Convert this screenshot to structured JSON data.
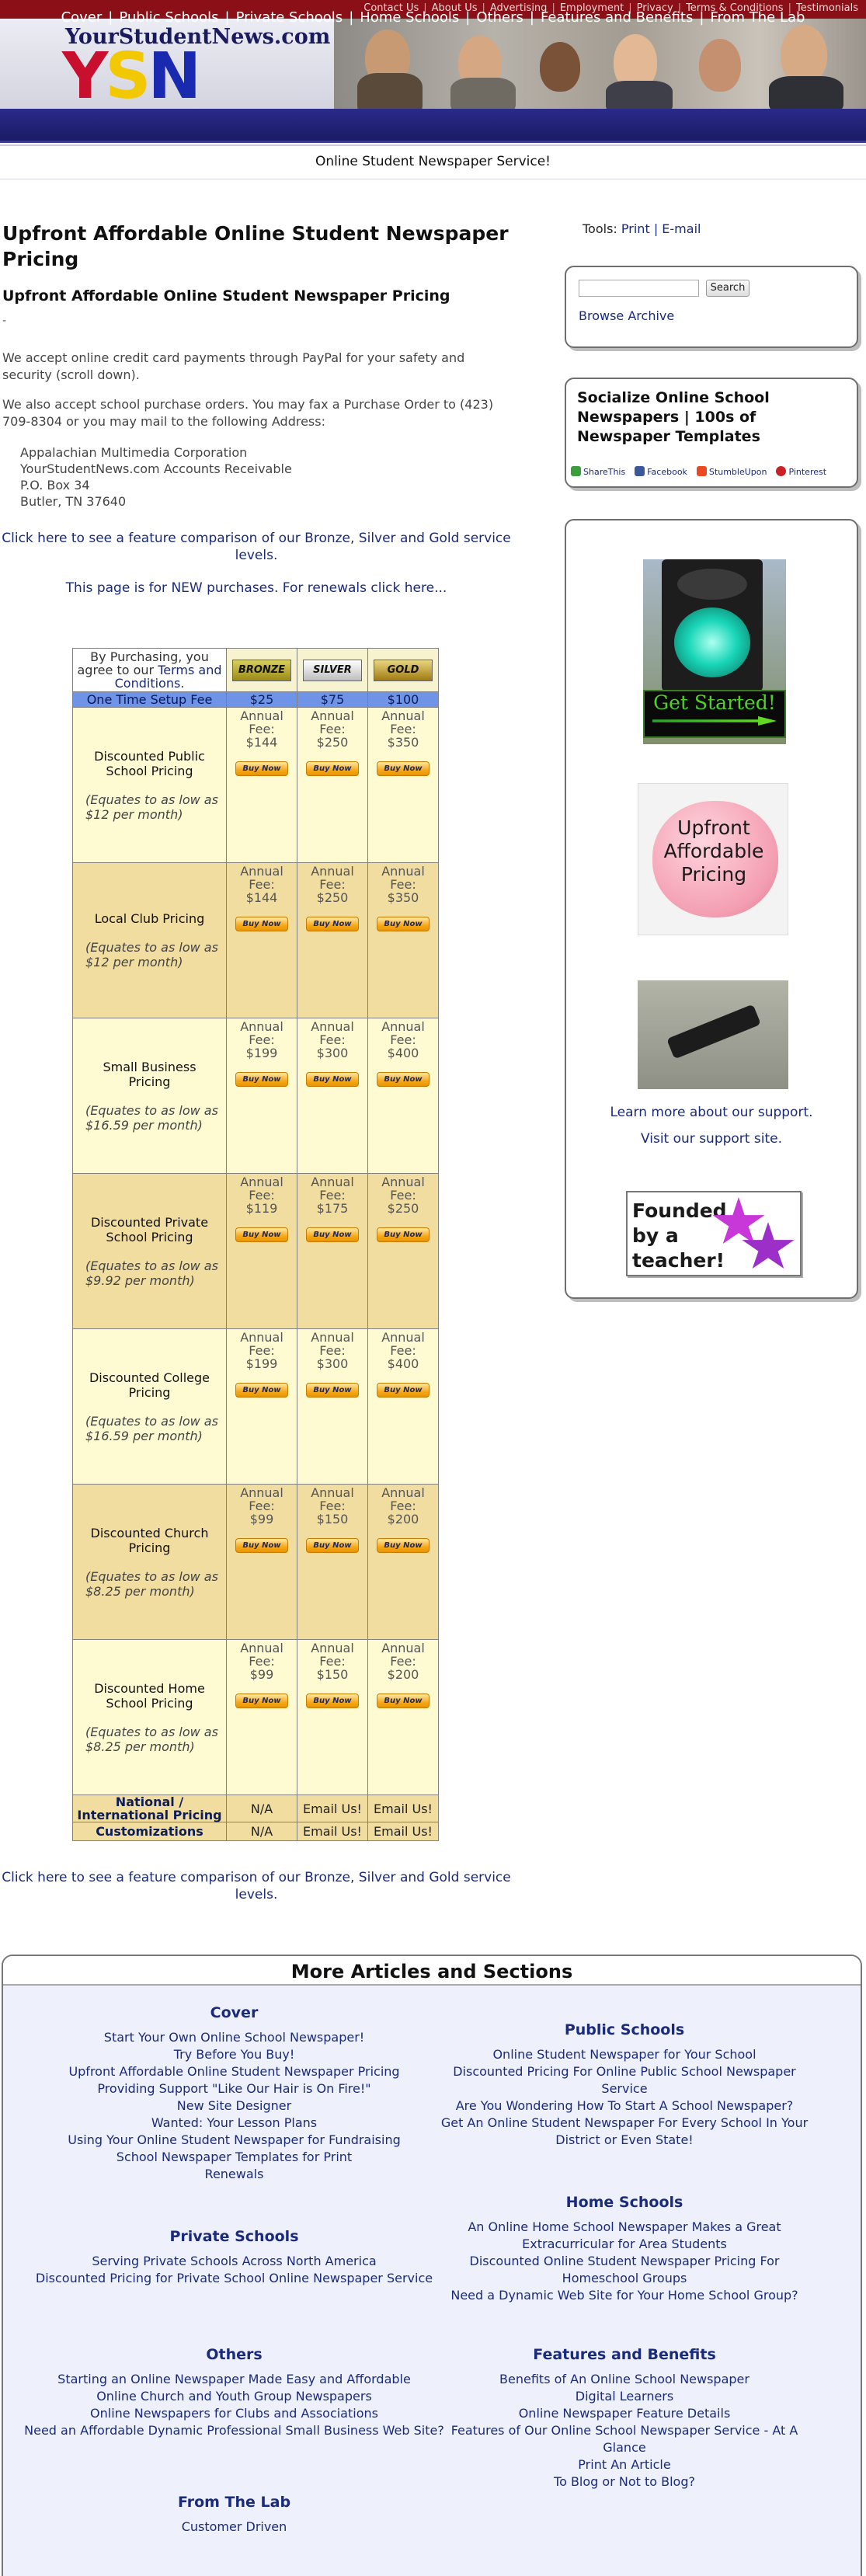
{
  "topnav": [
    "Contact Us",
    "About Us",
    "Advertising",
    "Employment",
    "Privacy",
    "Terms & Conditions",
    "Testimonials"
  ],
  "logo": {
    "site": "YourStudentNews.com",
    "letters": [
      "Y",
      "S",
      "N"
    ]
  },
  "mainnav": [
    "Cover",
    "Public Schools",
    "Private Schools",
    "Home Schools",
    "Others",
    "Features and Benefits",
    "From The Lab"
  ],
  "tagline": "Online Student Newspaper Service!",
  "page_title": "Upfront Affordable Online Student Newspaper Pricing",
  "subtitle": "Upfront Affordable Online Student Newspaper Pricing",
  "dash": "-",
  "para1": "We accept online credit card payments through PayPal for your safety and security (scroll down).",
  "para2": "We also accept school purchase orders.  You may fax a Purchase Order to (423) 709-8304 or you may mail to the following Address:",
  "address": [
    "Appalachian Multimedia Corporation",
    "YourStudentNews.com Accounts Receivable",
    "P.O. Box 34",
    "Butler, TN 37640"
  ],
  "compare_link": "Click here to see a feature comparison of our Bronze, Silver and Gold service levels.",
  "new_purchases": "This page is for NEW purchases.  For renewals click here...",
  "pricing": {
    "terms_prefix": "By Purchasing, you agree to our ",
    "terms_link": "Terms and Conditions.",
    "tiers": [
      "BRONZE",
      "SILVER",
      "GOLD"
    ],
    "setup_label": "One Time Setup Fee",
    "setup_fees": [
      "$25",
      "$75",
      "$100"
    ],
    "fee_word": "Annual",
    "fee_word2": "Fee:",
    "buy_label": "Buy Now",
    "plans": [
      {
        "name": "Discounted Public School Pricing",
        "note": "(Equates to as low as $12 per month)",
        "fees": [
          "$144",
          "$250",
          "$350"
        ]
      },
      {
        "name": "Local Club Pricing",
        "note": "(Equates to as low as $12 per month)",
        "fees": [
          "$144",
          "$250",
          "$350"
        ]
      },
      {
        "name": "Small Business Pricing",
        "note": "(Equates to as low as $16.59 per month)",
        "fees": [
          "$199",
          "$300",
          "$400"
        ]
      },
      {
        "name": "Discounted Private School Pricing",
        "note": "(Equates to as low as $9.92 per month)",
        "fees": [
          "$119",
          "$175",
          "$250"
        ]
      },
      {
        "name": "Discounted College Pricing",
        "note": "(Equates to as low as $16.59 per month)",
        "fees": [
          "$199",
          "$300",
          "$400"
        ]
      },
      {
        "name": "Discounted Church Pricing",
        "note": "(Equates to as low as $8.25 per month)",
        "fees": [
          "$99",
          "$150",
          "$200"
        ]
      },
      {
        "name": "Discounted Home School Pricing",
        "note": "(Equates to as low as $8.25 per month)",
        "fees": [
          "$99",
          "$150",
          "$200"
        ]
      }
    ],
    "national": {
      "name": "National / International Pricing",
      "values": [
        "N/A",
        "Email Us!",
        "Email Us!"
      ]
    },
    "custom": {
      "name": "Customizations",
      "values": [
        "N/A",
        "Email Us!",
        "Email Us!"
      ]
    }
  },
  "tools": {
    "label": "Tools:",
    "print": "Print",
    "sep": "|",
    "email": "E-mail"
  },
  "search": {
    "placeholder": "",
    "button": "Search",
    "browse": "Browse Archive"
  },
  "social": {
    "title": "Socialize Online School Newspapers | 100s of Newspaper Templates",
    "shares": [
      "ShareThis",
      "Facebook",
      "StumbleUpon",
      "Pinterest"
    ]
  },
  "promo": {
    "get_started": "Get Started!",
    "piggy_text": "Upfront Affordable Pricing",
    "learn_support": "Learn more about our support.",
    "visit_support": "Visit our support site.",
    "founded": "Founded by a teacher!"
  },
  "more": {
    "title": "More Articles and Sections",
    "cover": {
      "title": "Cover",
      "items": [
        "Start Your Own Online School Newspaper!",
        "Try Before You Buy!",
        "Upfront Affordable Online Student Newspaper Pricing",
        "Providing Support \"Like Our Hair is On Fire!\"",
        "New Site Designer",
        "Wanted: Your Lesson Plans",
        "Using Your Online Student Newspaper for Fundraising",
        "School Newspaper Templates for Print",
        "Renewals"
      ]
    },
    "public": {
      "title": "Public Schools",
      "items": [
        "Online Student Newspaper for Your School",
        "Discounted Pricing For Online Public School Newspaper Service",
        "Are You Wondering How To Start A School Newspaper?",
        "Get An Online Student Newspaper For Every School In Your District or Even State!"
      ]
    },
    "home": {
      "title": "Home Schools",
      "items": [
        "An Online Home School Newspaper Makes a Great Extracurricular for Area Students",
        "Discounted Online Student Newspaper Pricing For Homeschool Groups",
        "Need a Dynamic Web Site for Your Home School Group?"
      ]
    },
    "private": {
      "title": "Private Schools",
      "items": [
        "Serving Private Schools Across North America",
        "Discounted Pricing for Private School Online Newspaper Service"
      ]
    },
    "others": {
      "title": "Others",
      "items": [
        "Starting an Online Newspaper Made Easy and Affordable",
        "Online Church and Youth Group Newspapers",
        "Online Newspapers for Clubs and Associations",
        "Need an Affordable Dynamic Professional Small Business Web Site?"
      ]
    },
    "features": {
      "title": "Features and Benefits",
      "items": [
        "Benefits of An Online School Newspaper",
        "Digital Learners",
        "Online Newspaper Feature Details",
        "Features of Our Online School Newspaper Service - At A Glance",
        "Print An Article",
        "To Blog or Not to Blog?"
      ]
    },
    "lab": {
      "title": "From The Lab",
      "items": [
        "Customer Driven"
      ]
    }
  },
  "colors": {
    "topbar": "#8a0f16",
    "nav": "#1b1b66",
    "link": "#1a2a7c",
    "setup": "#6f93e6",
    "row_light": "#fefbd2",
    "row_dark": "#f1dda0"
  }
}
